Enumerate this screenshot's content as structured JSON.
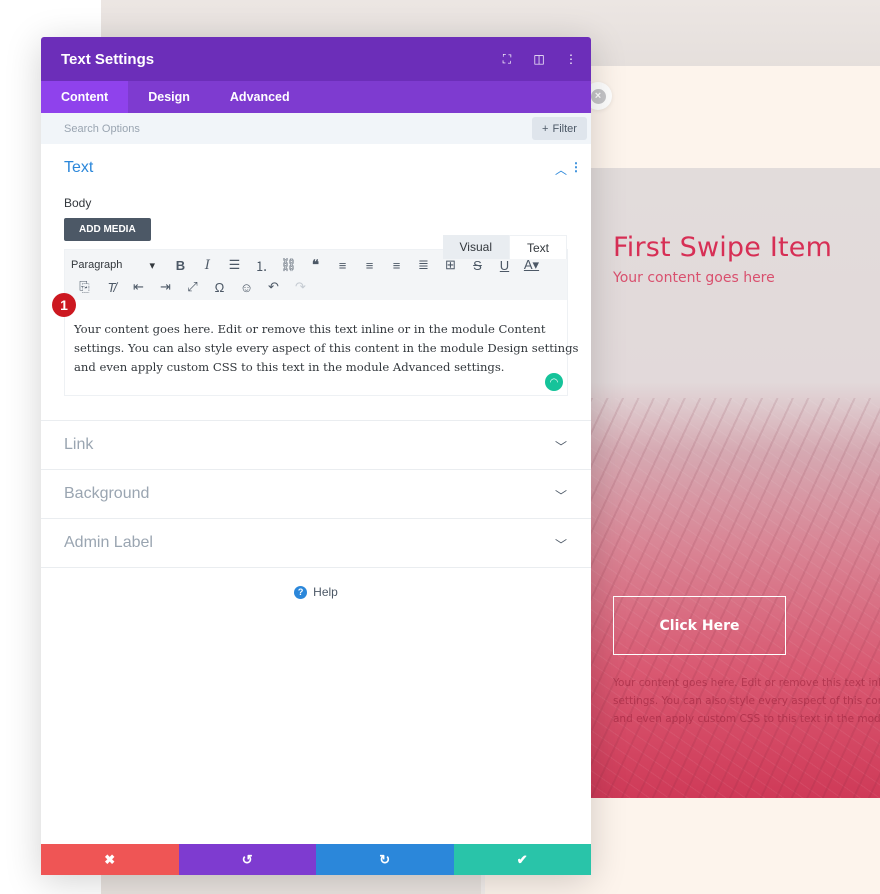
{
  "modal": {
    "title": "Text Settings",
    "header_icons": [
      "fullscreen-icon",
      "split-view-icon",
      "more-options-icon"
    ],
    "tabs": [
      {
        "label": "Content",
        "active": true
      },
      {
        "label": "Design",
        "active": false
      },
      {
        "label": "Advanced",
        "active": false
      }
    ],
    "search": {
      "placeholder": "Search Options",
      "filter_label": "Filter"
    },
    "sections": {
      "text": {
        "title": "Text",
        "body_label": "Body",
        "add_media_label": "ADD MEDIA",
        "editor_tabs": {
          "visual": "Visual",
          "text": "Text"
        },
        "format_select": "Paragraph",
        "content_lines": [
          "Your content goes here. Edit or remove this text inline or in the module Content",
          "settings. You can also style every aspect of this content in the module Design settings",
          "and even apply custom CSS to this text in the module Advanced settings."
        ],
        "step_badge": "1"
      },
      "link": {
        "title": "Link"
      },
      "background": {
        "title": "Background"
      },
      "admin_label": {
        "title": "Admin Label"
      }
    },
    "help_label": "Help"
  },
  "preview": {
    "title": "First Swipe Item",
    "subtitle": "Your content goes here",
    "button_label": "Click Here",
    "body_lines": [
      "Your content goes here. Edit or remove this text inli",
      "settings. You can also style every aspect of this con",
      "and even apply custom CSS to this text in the modul"
    ]
  },
  "colors": {
    "header_purple": "#6c2eb9",
    "tab_purple": "#7e3bd0",
    "active_tab": "#8f42ec",
    "accent_blue": "#2b87da",
    "cancel_red": "#ef5555",
    "save_green": "#29c4a9",
    "hero_pink": "#d72f55"
  }
}
